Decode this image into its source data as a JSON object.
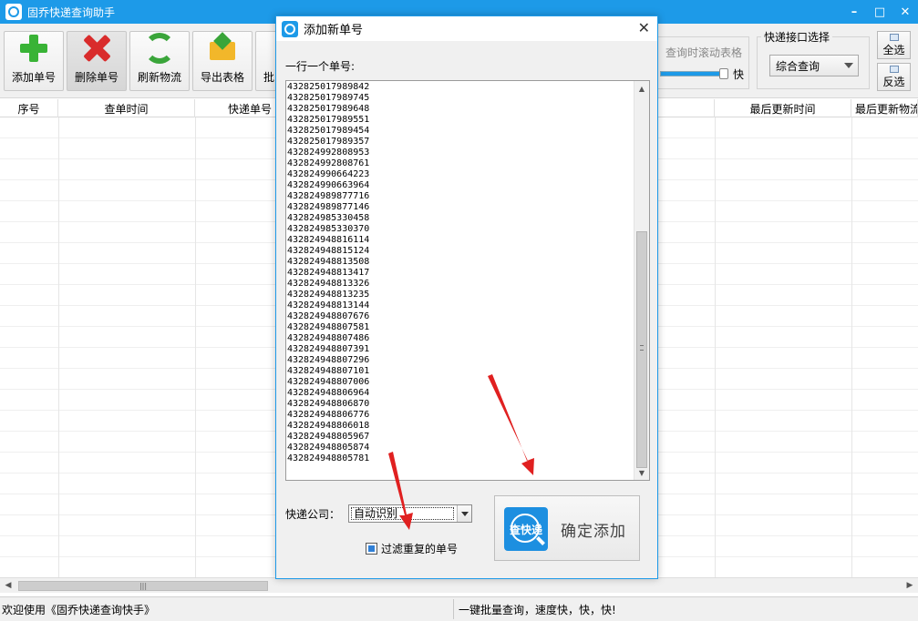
{
  "window": {
    "title": "固乔快递查询助手",
    "controls": {
      "minimize": "–",
      "maximize": "□",
      "close": "✕"
    }
  },
  "toolbar": {
    "buttons": [
      {
        "label": "添加单号",
        "icon": "add-icon"
      },
      {
        "label": "删除单号",
        "icon": "delete-icon"
      },
      {
        "label": "刷新物流",
        "icon": "refresh-icon"
      },
      {
        "label": "导出表格",
        "icon": "export-icon"
      },
      {
        "label": "批",
        "icon": "batch-icon"
      }
    ],
    "scroll_option": {
      "label": "查询时滚动表格",
      "fast_label": "快",
      "enabled": false
    },
    "api_group": {
      "legend": "快递接口选择",
      "selected": "综合查询"
    },
    "select_all": "全选",
    "invert_select": "反选"
  },
  "grid": {
    "columns": [
      "序号",
      "查单时间",
      "快递单号",
      "最后更新时间",
      "最后更新物流"
    ],
    "hscroll_grip": "|||"
  },
  "status": {
    "left": "欢迎使用《固乔快递查询快手》",
    "right": "一键批量查询，速度快，快，快!"
  },
  "dialog": {
    "title": "添加新单号",
    "close": "✕",
    "prompt": "一行一个单号:",
    "tracking_numbers": [
      "432825017989842",
      "432825017989745",
      "432825017989648",
      "432825017989551",
      "432825017989454",
      "432825017989357",
      "432824992808953",
      "432824992808761",
      "432824990664223",
      "432824990663964",
      "432824989877716",
      "432824989877146",
      "432824985330458",
      "432824985330370",
      "432824948816114",
      "432824948815124",
      "432824948813508",
      "432824948813417",
      "432824948813326",
      "432824948813235",
      "432824948813144",
      "432824948807676",
      "432824948807581",
      "432824948807486",
      "432824948807391",
      "432824948807296",
      "432824948807101",
      "432824948807006",
      "432824948806964",
      "432824948806870",
      "432824948806776",
      "432824948806018",
      "432824948805967",
      "432824948805874",
      "432824948805781"
    ],
    "company_label": "快递公司：",
    "company_selected": "自动识别",
    "filter_label": "过滤重复的单号",
    "filter_checked": true,
    "confirm_logo_text": "查快递",
    "confirm_label": "确定添加"
  }
}
